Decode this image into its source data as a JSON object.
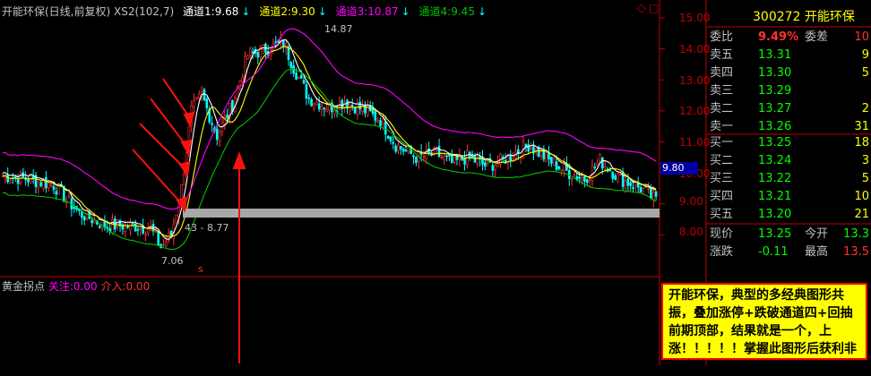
{
  "header": {
    "title": "开能环保(日线,前复权) XS2(102,7)",
    "ch1_label": "通道1:",
    "ch1_value": "9.68",
    "ch2_label": "通道2:",
    "ch2_value": "9.30",
    "ch3_label": "通道3:",
    "ch3_value": "10.87",
    "ch4_label": "通道4:",
    "ch4_value": "9.45",
    "arrow": "↓",
    "diamond": "◇",
    "square": "□"
  },
  "price_axis": [
    "15.00",
    "14.00",
    "13.00",
    "12.00",
    "11.00",
    "10.00",
    "9.00",
    "8.00"
  ],
  "price_tag": "9.80",
  "annotations": {
    "high": "14.87",
    "range": "43 - 8.77",
    "low": "7.06",
    "marker": "s"
  },
  "sub_indicator": {
    "name": "黄金拐点",
    "focus_label": "关注:",
    "focus_value": "0.00",
    "enter_label": "介入:",
    "enter_value": "0.00"
  },
  "order_book": {
    "code": "300272",
    "name": "开能环保",
    "ratio_label": "委比",
    "ratio_value": "9.49%",
    "diff_label": "委差",
    "diff_value": "10",
    "asks": [
      {
        "label": "卖五",
        "price": "13.31",
        "vol": "9"
      },
      {
        "label": "卖四",
        "price": "13.30",
        "vol": "5"
      },
      {
        "label": "卖三",
        "price": "13.29",
        "vol": ""
      },
      {
        "label": "卖二",
        "price": "13.27",
        "vol": "2"
      },
      {
        "label": "卖一",
        "price": "13.26",
        "vol": "31"
      }
    ],
    "bids": [
      {
        "label": "买一",
        "price": "13.25",
        "vol": "18"
      },
      {
        "label": "买二",
        "price": "13.24",
        "vol": "3"
      },
      {
        "label": "买三",
        "price": "13.22",
        "vol": "5"
      },
      {
        "label": "买四",
        "price": "13.21",
        "vol": "10"
      },
      {
        "label": "买五",
        "price": "13.20",
        "vol": "21"
      }
    ],
    "current_label": "现价",
    "current_value": "13.25",
    "open_label": "今开",
    "open_value": "13.3",
    "change_label": "涨跌",
    "change_value": "-0.11",
    "high_label": "最高",
    "high_value": "13.5"
  },
  "note_text": "开能环保，典型的多经典图形共振，叠加涨停+跌破通道四+回抽前期顶部，结果就是一个，上涨！！！！！掌握此图形后获利非常简单",
  "colors": {
    "up": "#ff3232",
    "down": "#00ffff",
    "ch1": "#ffffff",
    "ch2": "#ffff00",
    "ch3": "#ff00ff",
    "ch4": "#00c000",
    "axis": "#c00000"
  }
}
